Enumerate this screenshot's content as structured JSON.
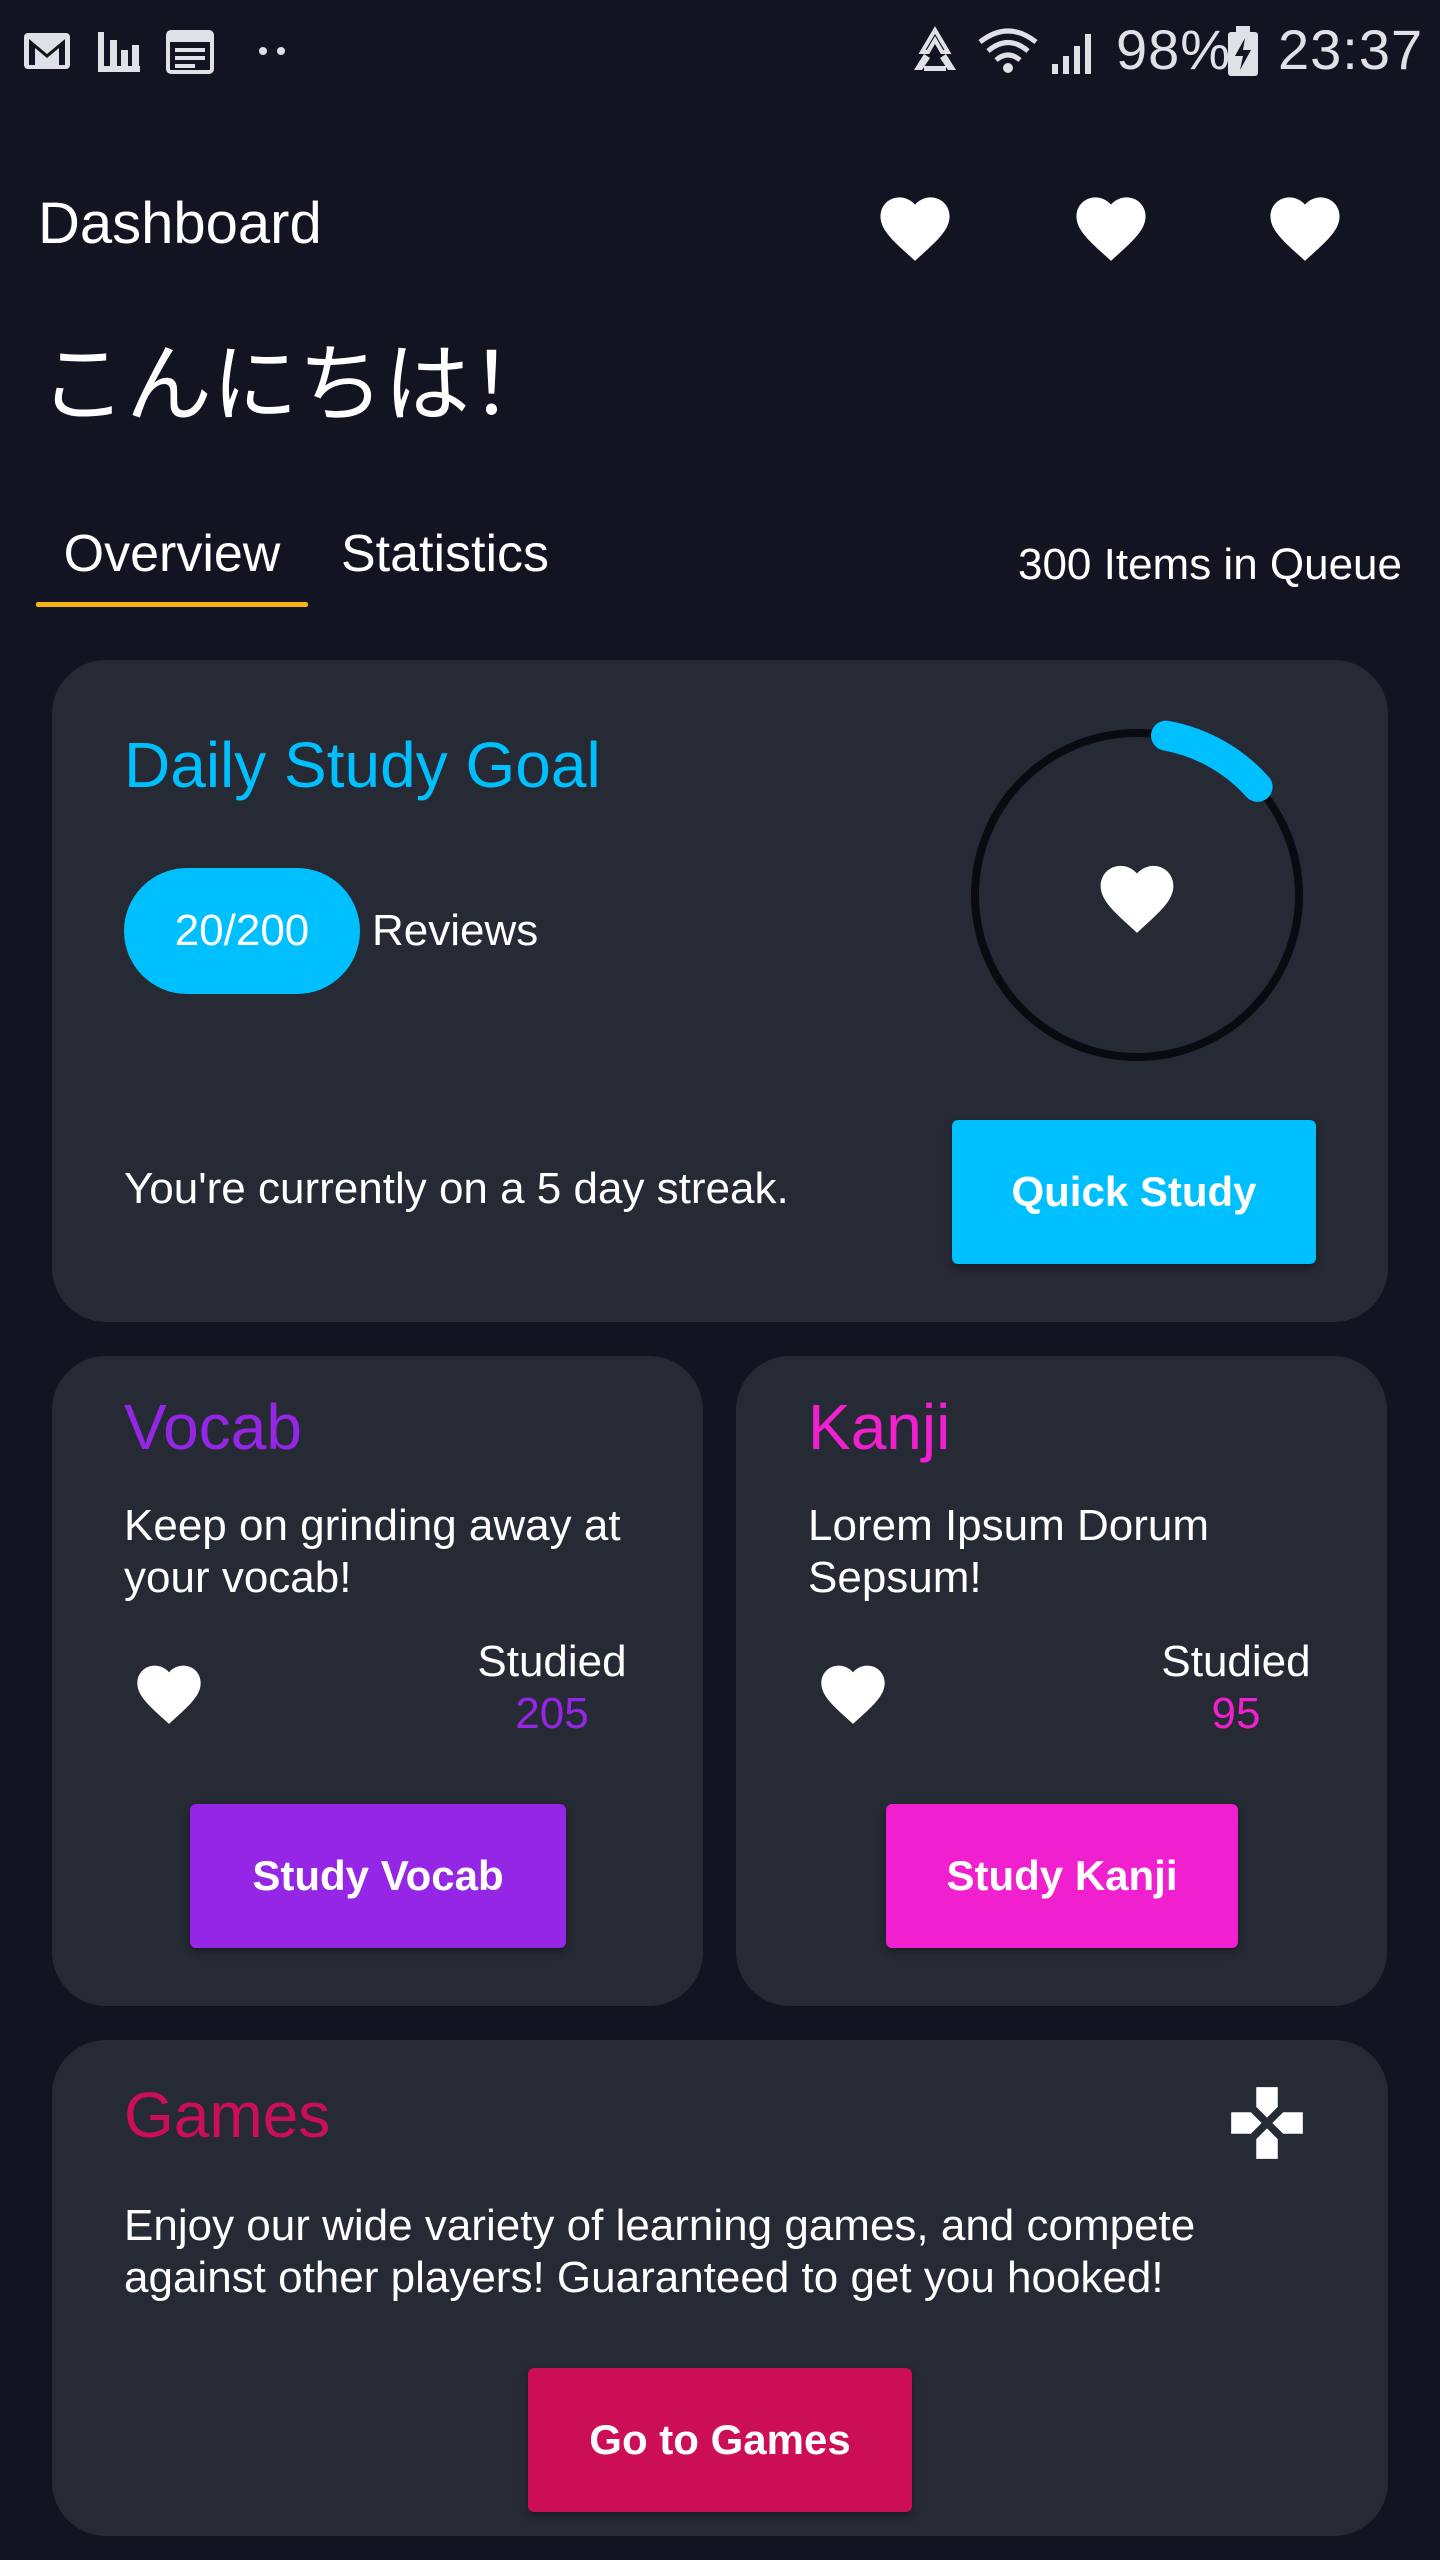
{
  "status_bar": {
    "battery": "98%",
    "time": "23:37",
    "left_icons": [
      "gmail-icon",
      "bar-chart-icon",
      "calendar-icon",
      "more-dots-icon"
    ],
    "right_icons": [
      "recycle-icon",
      "wifi-icon",
      "signal-icon",
      "battery-charging-icon"
    ]
  },
  "app_bar": {
    "title": "Dashboard",
    "action_icons": [
      "heart-icon",
      "heart-icon",
      "heart-icon"
    ]
  },
  "greeting": "こんにちは！",
  "tabs": [
    {
      "label": "Overview",
      "active": true
    },
    {
      "label": "Statistics",
      "active": false
    }
  ],
  "queue": "300 Items in Queue",
  "daily_goal": {
    "title": "Daily Study Goal",
    "reviews_count": "20/200",
    "reviews_label": "Reviews",
    "progress": 0.1,
    "streak_text": "You're currently on a 5 day streak.",
    "button_label": "Quick Study",
    "accent_color": "#00bfff"
  },
  "vocab": {
    "title": "Vocab",
    "description": "Keep on grinding away at your vocab!",
    "studied_label": "Studied",
    "studied_value": "205",
    "button_label": "Study Vocab",
    "accent_color": "#9526e6"
  },
  "kanji": {
    "title": "Kanji",
    "description": "Lorem Ipsum Dorum Sepsum!",
    "studied_label": "Studied",
    "studied_value": "95",
    "button_label": "Study Kanji",
    "accent_color": "#f020cf"
  },
  "games": {
    "title": "Games",
    "description": "Enjoy our wide variety of learning games, and compete against other players! Guaranteed to get you hooked!",
    "button_label": "Go to Games",
    "icon": "gamepad-icon",
    "accent_color": "#cc0e56"
  }
}
